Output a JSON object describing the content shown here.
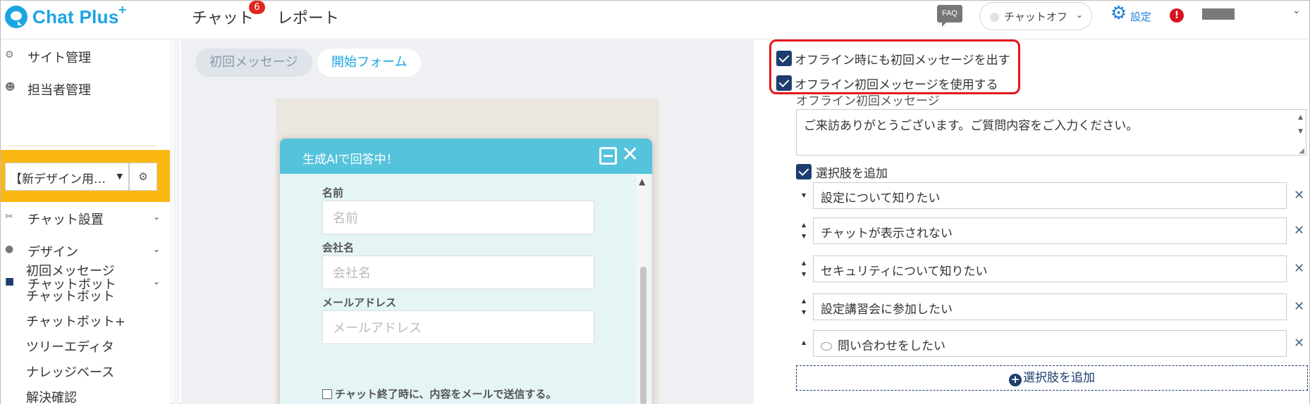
{
  "header": {
    "logo_text": "Chat Plus",
    "logo_plus": "+",
    "nav": [
      {
        "label": "チャット",
        "badge": "6"
      },
      {
        "label": "レポート"
      }
    ],
    "faq_label": "FAQ",
    "status_select": "チャットオフ",
    "settings_label": "設定",
    "alert_icon": "!"
  },
  "sidebar": {
    "items": [
      {
        "label": "サイト管理",
        "icon": "gears-icon"
      },
      {
        "label": "担当者管理",
        "icon": "users-icon"
      }
    ],
    "site_select": "【新デザイン用…",
    "sections": [
      {
        "label": "チャット設置",
        "icon": "tools-icon"
      },
      {
        "label": "デザイン",
        "icon": "palette-icon"
      },
      {
        "label": "チャットボット",
        "icon": "chat-icon"
      }
    ],
    "sub_items": [
      "初回メッセージ",
      "チャットボット",
      "チャットボット+",
      "ツリーエディタ",
      "ナレッジベース",
      "解決確認"
    ]
  },
  "preview": {
    "tabs": [
      "初回メッセージ",
      "開始フォーム"
    ],
    "active_tab": "開始フォーム",
    "chat_title": "生成AIで回答中！",
    "fields": [
      {
        "label": "名前",
        "placeholder": "名前"
      },
      {
        "label": "会社名",
        "placeholder": "会社名"
      },
      {
        "label": "メールアドレス",
        "placeholder": "メールアドレス"
      }
    ],
    "mail_checkbox_label": "チャット終了時に、内容をメールで送信する。"
  },
  "settings": {
    "offline_first_message": {
      "label": "オフライン時にも初回メッセージを出す",
      "checked": true
    },
    "use_offline_message": {
      "label": "オフライン初回メッセージを使用する",
      "checked": true
    },
    "offline_message_label": "オフライン初回メッセージ",
    "offline_message_text": "ご来訪ありがとうございます。ご質問内容をご入力ください。",
    "add_choices": {
      "label": "選択肢を追加",
      "checked": true
    },
    "choices": [
      "設定について知りたい",
      "チャットが表示されない",
      "セキュリティについて知りたい",
      "設定講習会に参加したい",
      "問い合わせをしたい"
    ],
    "add_choice_button": "選択肢を追加"
  },
  "colors": {
    "brand": "#1aa5e3",
    "chat_header": "#55c3dc",
    "highlight": "#e6151b",
    "checkbox": "#1d3d6e",
    "sidebar_accent": "#fbb812",
    "badge": "#e0261c"
  }
}
